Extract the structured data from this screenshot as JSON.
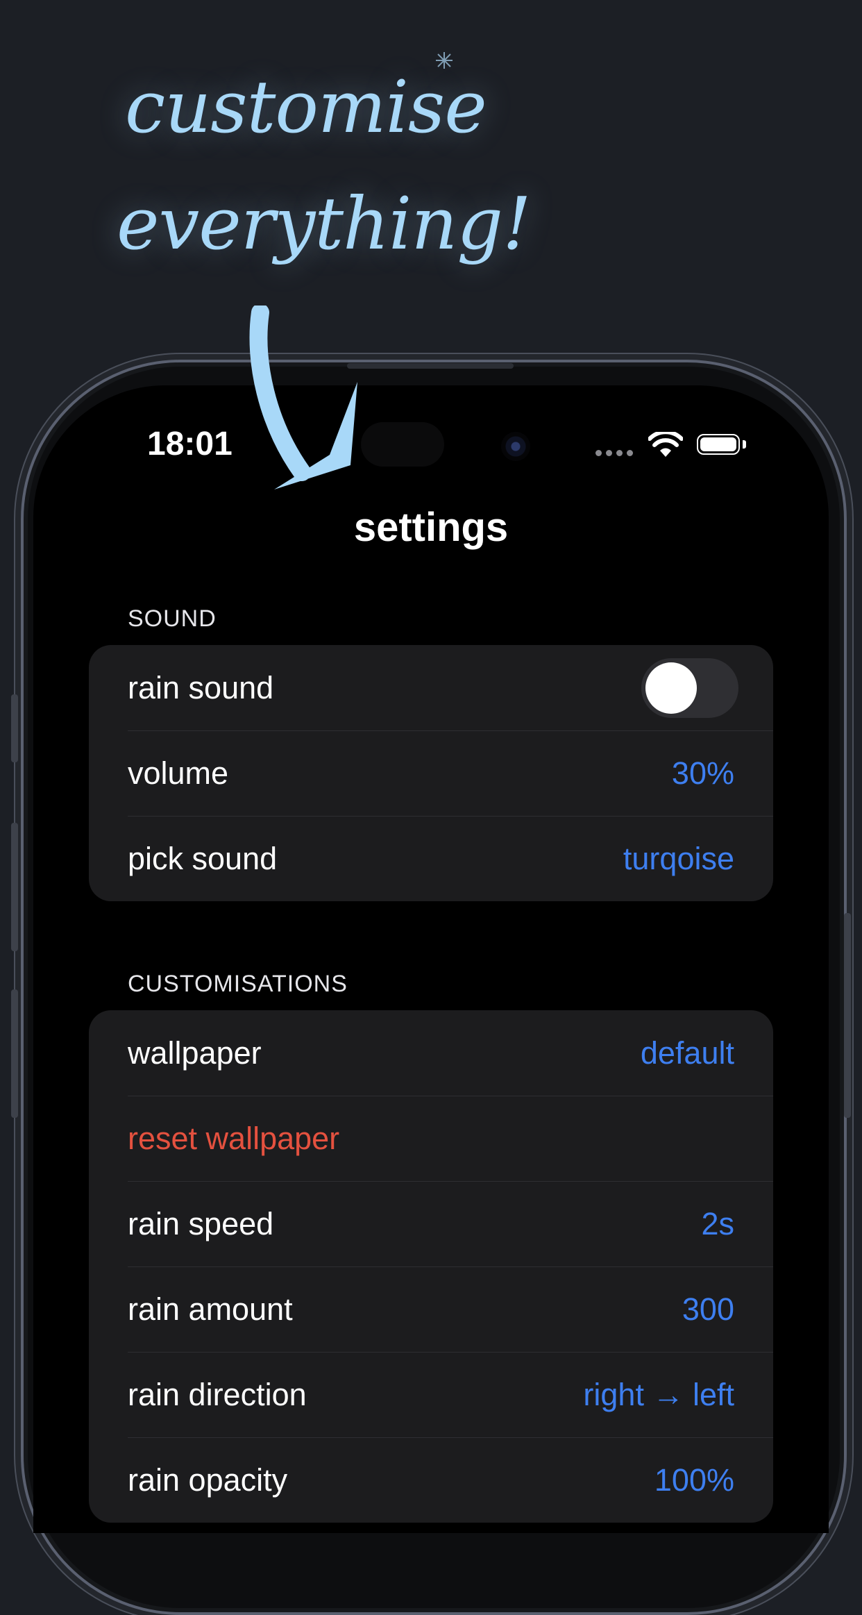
{
  "promo": {
    "line1": "customise",
    "line2": "everything!"
  },
  "status_bar": {
    "time": "18:01"
  },
  "page_title": "settings",
  "sections": {
    "sound": {
      "header": "SOUND",
      "rows": {
        "rain_sound": {
          "label": "rain sound",
          "toggle_on": false
        },
        "volume": {
          "label": "volume",
          "value": "30%"
        },
        "pick_sound": {
          "label": "pick sound",
          "value": "turqoise"
        }
      }
    },
    "customisations": {
      "header": "CUSTOMISATIONS",
      "rows": {
        "wallpaper": {
          "label": "wallpaper",
          "value": "default"
        },
        "reset_wallpaper": {
          "label": "reset wallpaper"
        },
        "rain_speed": {
          "label": "rain speed",
          "value": "2s"
        },
        "rain_amount": {
          "label": "rain amount",
          "value": "300"
        },
        "rain_direction": {
          "label": "rain direction",
          "value": "right → left"
        },
        "rain_opacity": {
          "label": "rain opacity",
          "value": "100%"
        }
      }
    }
  },
  "colors": {
    "accent": "#3e7ff0",
    "danger": "#e4513f",
    "promo_text": "#a8d8f8",
    "group_bg": "#1c1c1e"
  }
}
